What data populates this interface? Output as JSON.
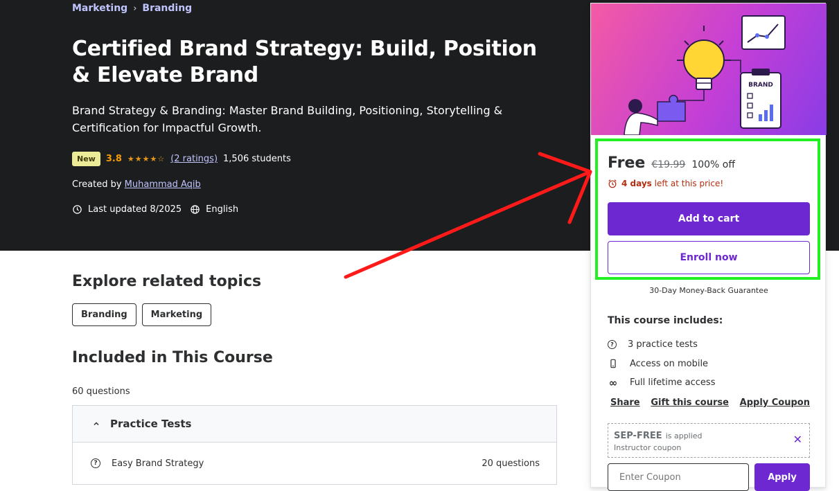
{
  "breadcrumb": {
    "items": [
      "Marketing",
      "Branding"
    ],
    "separator": "›"
  },
  "course": {
    "title": "Certified Brand Strategy: Build, Position & Elevate Brand",
    "subtitle": "Brand Strategy & Branding: Master Brand Building, Positioning, Storytelling & Certification for Impactful Growth.",
    "badge": "New",
    "rating": "3.8",
    "stars": "★★★★☆",
    "ratings_count": "(2 ratings)",
    "students": "1,506 students",
    "created_by_label": "Created by",
    "instructor": "Muhammad Aqib",
    "last_updated": "Last updated 8/2025",
    "language": "English"
  },
  "related": {
    "heading": "Explore related topics",
    "topics": [
      "Branding",
      "Marketing"
    ]
  },
  "included": {
    "heading": "Included in This Course",
    "questions_total": "60 questions",
    "section_title": "Practice Tests",
    "rows": [
      {
        "name": "Easy Brand Strategy",
        "count": "20 questions"
      }
    ]
  },
  "sidebar": {
    "price": {
      "current": "Free",
      "original": "€19.99",
      "discount": "100% off"
    },
    "timer": {
      "bold": "4 days",
      "rest": "left at this price!"
    },
    "add_to_cart": "Add to cart",
    "enroll_now": "Enroll now",
    "guarantee": "30-Day Money-Back Guarantee",
    "includes_heading": "This course includes:",
    "includes": [
      {
        "icon": "question-circle-icon",
        "text": "3 practice tests"
      },
      {
        "icon": "mobile-icon",
        "text": "Access on mobile"
      },
      {
        "icon": "infinity-icon",
        "text": "Full lifetime access"
      }
    ],
    "actions": [
      "Share",
      "Gift this course",
      "Apply Coupon"
    ],
    "coupon": {
      "code": "SEP-FREE",
      "applied": "is applied",
      "type": "Instructor coupon"
    },
    "coupon_input_placeholder": "Enter Coupon",
    "apply_label": "Apply",
    "preview_text": "BRAND"
  },
  "colors": {
    "accent": "#6d28d2",
    "hero_bg": "#1c1d1f",
    "highlight_box": "#22f022",
    "annotation_arrow": "#ff1a1a",
    "timer_red": "#b32d0f"
  }
}
